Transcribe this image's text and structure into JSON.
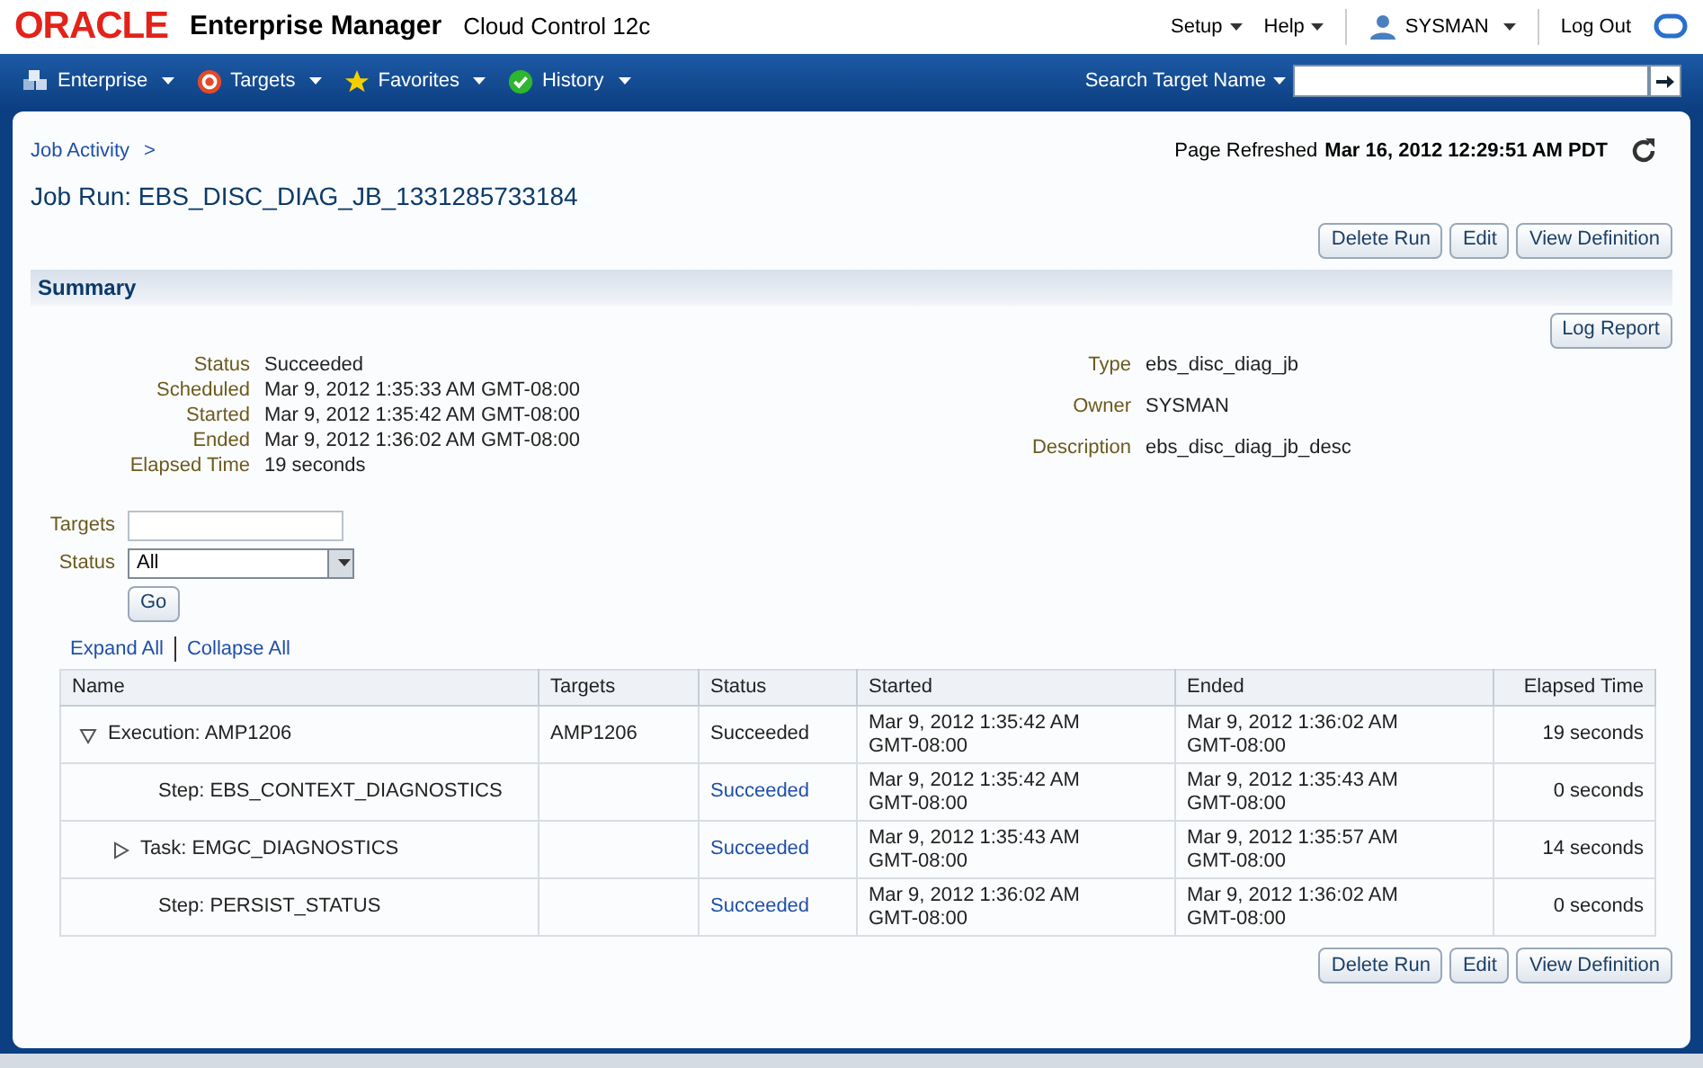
{
  "header": {
    "brand": "ORACLE",
    "product": "Enterprise Manager",
    "edition": "Cloud Control 12c",
    "menus": [
      "Setup",
      "Help"
    ],
    "user": "SYSMAN",
    "logout": "Log Out"
  },
  "nav": {
    "items": [
      "Enterprise",
      "Targets",
      "Favorites",
      "History"
    ],
    "search_label": "Search Target Name"
  },
  "breadcrumb": "Job Activity",
  "breadcrumb_sep": ">",
  "page_title": "Job Run: EBS_DISC_DIAG_JB_1331285733184",
  "refresh": {
    "label": "Page Refreshed",
    "value": "Mar 16, 2012 12:29:51 AM PDT"
  },
  "buttons": [
    "Delete Run",
    "Edit",
    "View Definition"
  ],
  "bottom_buttons": [
    "Delete Run",
    "Edit",
    "View Definition"
  ],
  "summary": {
    "title": "Summary",
    "log_button": "Log Report",
    "left": [
      {
        "label": "Status",
        "value": "Succeeded"
      },
      {
        "label": "Scheduled",
        "value": "Mar 9, 2012 1:35:33 AM GMT-08:00"
      },
      {
        "label": "Started",
        "value": "Mar 9, 2012 1:35:42 AM GMT-08:00"
      },
      {
        "label": "Ended",
        "value": "Mar 9, 2012 1:36:02 AM GMT-08:00"
      },
      {
        "label": "Elapsed Time",
        "value": "19 seconds"
      }
    ],
    "right": [
      {
        "label": "Type",
        "value": "ebs_disc_diag_jb"
      },
      {
        "label": "Owner",
        "value": "SYSMAN"
      },
      {
        "label": "Description",
        "value": "ebs_disc_diag_jb_desc"
      }
    ]
  },
  "filters": {
    "targets_label": "Targets",
    "status_label": "Status",
    "status_value": "All",
    "go": "Go"
  },
  "tree_links": [
    "Expand All",
    "Collapse All"
  ],
  "table": {
    "columns": [
      "Name",
      "Targets",
      "Status",
      "Started",
      "Ended",
      "Elapsed Time"
    ],
    "rows": [
      {
        "kind": "execution",
        "expanded": true,
        "name": "Execution: AMP1206",
        "targets": "AMP1206",
        "status": "Succeeded",
        "started": "Mar 9, 2012 1:35:42 AM GMT-08:00",
        "ended": "Mar 9, 2012 1:36:02 AM GMT-08:00",
        "elapsed": "19 seconds",
        "children": [
          {
            "kind": "step",
            "name": "Step: EBS_CONTEXT_DIAGNOSTICS",
            "status": "Succeeded",
            "started": "Mar 9, 2012 1:35:42 AM GMT-08:00",
            "ended": "Mar 9, 2012 1:35:43 AM GMT-08:00",
            "elapsed": "0 seconds"
          },
          {
            "kind": "task",
            "expanded": false,
            "name": "Task: EMGC_DIAGNOSTICS",
            "status": "Succeeded",
            "started": "Mar 9, 2012 1:35:43 AM GMT-08:00",
            "ended": "Mar 9, 2012 1:35:57 AM GMT-08:00",
            "elapsed": "14 seconds"
          },
          {
            "kind": "step",
            "name": "Step: PERSIST_STATUS",
            "status": "Succeeded",
            "started": "Mar 9, 2012 1:36:02 AM GMT-08:00",
            "ended": "Mar 9, 2012 1:36:02 AM GMT-08:00",
            "elapsed": "0 seconds"
          }
        ]
      }
    ]
  }
}
